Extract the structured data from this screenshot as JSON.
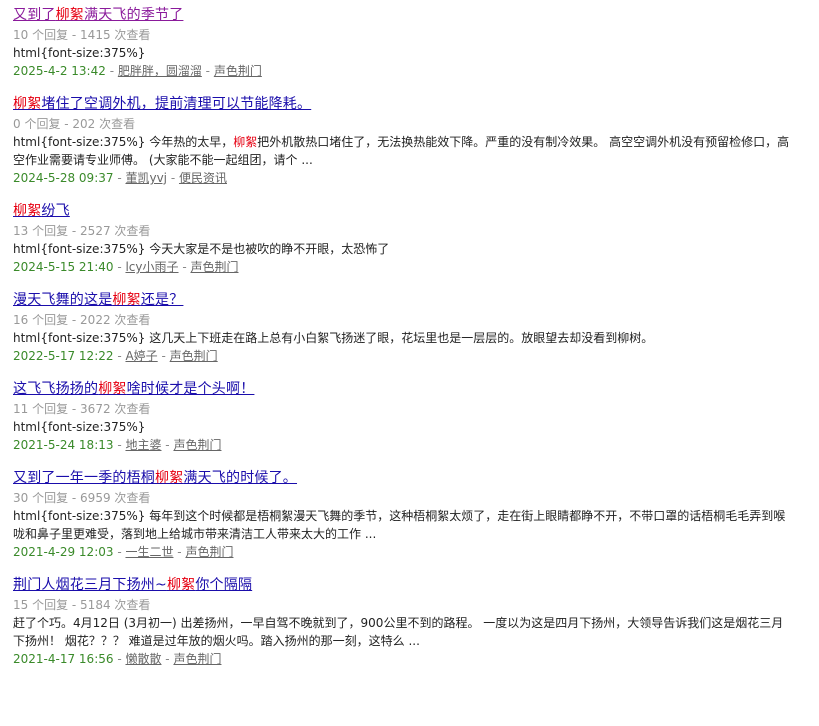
{
  "results": [
    {
      "title_pre": "又到了",
      "title_key": "柳絮",
      "title_post": "满天飞的季节了",
      "visited": true,
      "stats": "10 个回复 - 1415 次查看",
      "snippet_pre": "html{font-size:375%}",
      "snippet_key": "",
      "snippet_post": "",
      "date": "2025-4-2 13:42",
      "sep1": " - ",
      "author": "肥胖胖，圆溜溜",
      "sep2": " - ",
      "forum": "声色荆门"
    },
    {
      "title_pre": "",
      "title_key": "柳絮",
      "title_post": "堵住了空调外机，提前清理可以节能降耗。",
      "visited": false,
      "stats": "0 个回复 - 202 次查看",
      "snippet_pre": "html{font-size:375%} 今年热的太早，",
      "snippet_key": "柳絮",
      "snippet_post": "把外机散热口堵住了，无法换热能效下降。严重的没有制冷效果。 高空空调外机没有预留检修口，高空作业需要请专业师傅。 (大家能不能一起组团，请个 ...",
      "date": "2024-5-28 09:37",
      "sep1": " - ",
      "author": "董凯yvj",
      "sep2": " - ",
      "forum": "便民资讯"
    },
    {
      "title_pre": "",
      "title_key": "柳絮",
      "title_post": "纷飞",
      "visited": false,
      "stats": "13 个回复 - 2527 次查看",
      "snippet_pre": "html{font-size:375%} 今天大家是不是也被吹的睁不开眼，太恐怖了",
      "snippet_key": "",
      "snippet_post": "",
      "date": "2024-5-15 21:40",
      "sep1": " - ",
      "author": "lcy小雨子",
      "sep2": " - ",
      "forum": "声色荆门"
    },
    {
      "title_pre": "漫天飞舞的这是",
      "title_key": "柳絮",
      "title_post": "还是？",
      "visited": false,
      "stats": "16 个回复 - 2022 次查看",
      "snippet_pre": "html{font-size:375%} 这几天上下班走在路上总有小白絮飞扬迷了眼，花坛里也是一层层的。放眼望去却没看到柳树。",
      "snippet_key": "",
      "snippet_post": "",
      "date": "2022-5-17 12:22",
      "sep1": " - ",
      "author": "A婷子",
      "sep2": " - ",
      "forum": "声色荆门"
    },
    {
      "title_pre": "这飞飞扬扬的",
      "title_key": "柳絮",
      "title_post": "啥时候才是个头啊！",
      "visited": false,
      "stats": "11 个回复 - 3672 次查看",
      "snippet_pre": "html{font-size:375%}",
      "snippet_key": "",
      "snippet_post": "",
      "date": "2021-5-24 18:13",
      "sep1": " - ",
      "author": "地主婆",
      "sep2": " - ",
      "forum": "声色荆门"
    },
    {
      "title_pre": "又到了一年一季的梧桐",
      "title_key": "柳絮",
      "title_post": "满天飞的时候了。",
      "visited": false,
      "stats": "30 个回复 - 6959 次查看",
      "snippet_pre": "html{font-size:375%} 每年到这个时候都是梧桐絮漫天飞舞的季节，这种梧桐絮太烦了，走在街上眼睛都睁不开，不带口罩的话梧桐毛毛弄到喉咙和鼻子里更难受，落到地上给城市带来清洁工人带来太大的工作 ...",
      "snippet_key": "",
      "snippet_post": "",
      "date": "2021-4-29 12:03",
      "sep1": " - ",
      "author": "一生二世",
      "sep2": " - ",
      "forum": "声色荆门"
    },
    {
      "title_pre": "荆门人烟花三月下扬州~",
      "title_key": "柳絮",
      "title_post": "你个隔隔",
      "visited": false,
      "stats": "15 个回复 - 5184 次查看",
      "snippet_pre": "赶了个巧。4月12日 (3月初一) 出差扬州，一早自驾不晚就到了，900公里不到的路程。 一度以为这是四月下扬州，大领导告诉我们这是烟花三月下扬州！ 烟花？？？ 难道是过年放的烟火吗。踏入扬州的那一刻，这特么 ...",
      "snippet_key": "",
      "snippet_post": "",
      "date": "2021-4-17 16:56",
      "sep1": " - ",
      "author": "懒散散",
      "sep2": " - ",
      "forum": "声色荆门"
    }
  ]
}
